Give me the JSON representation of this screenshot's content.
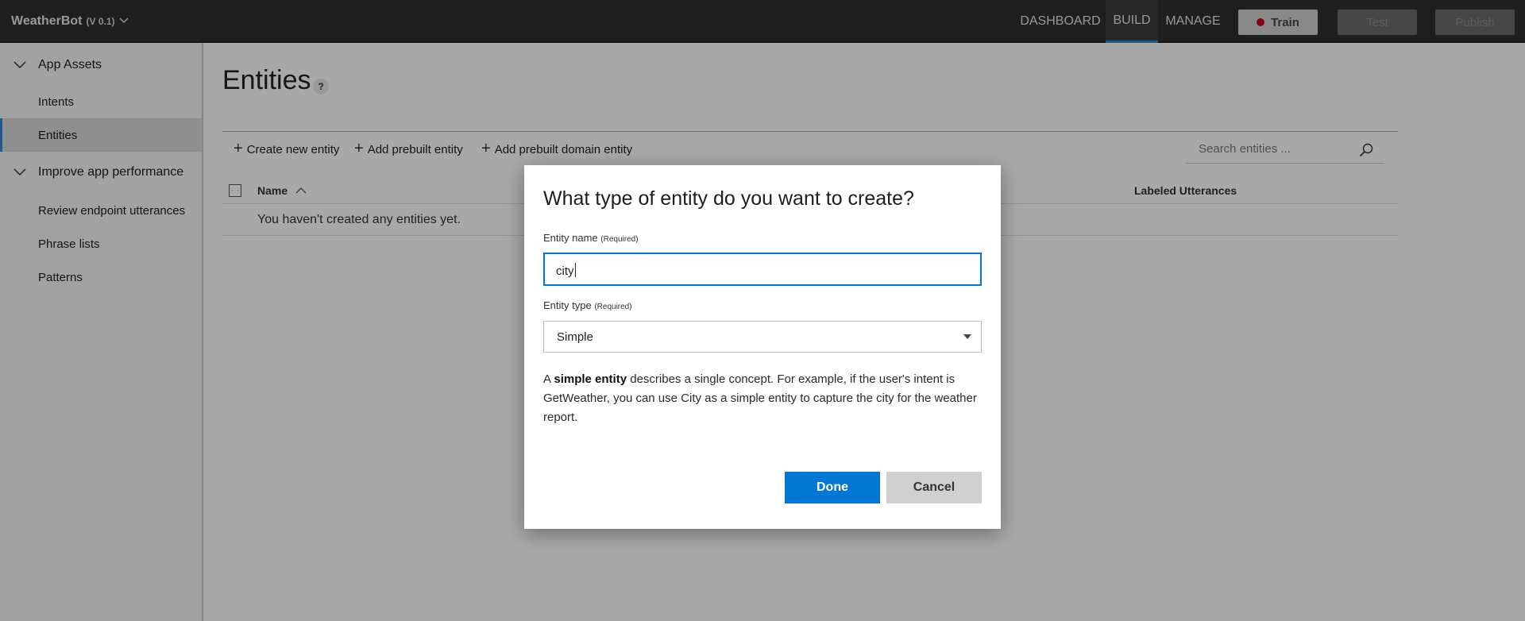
{
  "header": {
    "app_name": "WeatherBot",
    "version": "(V 0.1)",
    "nav": {
      "dashboard": "DASHBOARD",
      "build": "BUILD",
      "manage": "MANAGE"
    },
    "active_nav": "BUILD",
    "buttons": {
      "train": "Train",
      "test": "Test",
      "publish": "Publish"
    },
    "train_status_color": "#d3021f",
    "accent_color": "#2b88d8"
  },
  "sidebar": {
    "sections": [
      {
        "title": "App Assets",
        "items": [
          "Intents",
          "Entities"
        ]
      },
      {
        "title": "Improve app performance",
        "items": [
          "Review endpoint utterances",
          "Phrase lists",
          "Patterns"
        ]
      }
    ],
    "active_item": "Entities"
  },
  "main": {
    "title": "Entities",
    "help": "?",
    "toolbar": {
      "create": "Create new entity",
      "add_prebuilt": "Add prebuilt entity",
      "add_prebuilt_domain": "Add prebuilt domain entity"
    },
    "search": {
      "placeholder": "Search entities ..."
    },
    "table": {
      "columns": [
        "Name",
        "Labeled Utterances"
      ],
      "sort_column": "Name",
      "sort_direction": "ascending",
      "empty_message": "You haven't created any entities yet."
    }
  },
  "dialog": {
    "title": "What type of entity do you want to create?",
    "name_label": "Entity name",
    "name_required": "(Required)",
    "name_value": "city",
    "type_label": "Entity type",
    "type_required": "(Required)",
    "type_value": "Simple",
    "description": {
      "prefix": "A ",
      "bold": "simple entity",
      "rest": " describes a single concept. For example, if the user's intent is GetWeather, you can use City as a simple entity to capture the city for the weather report."
    },
    "done": "Done",
    "cancel": "Cancel",
    "primary_color": "#0078d4"
  }
}
